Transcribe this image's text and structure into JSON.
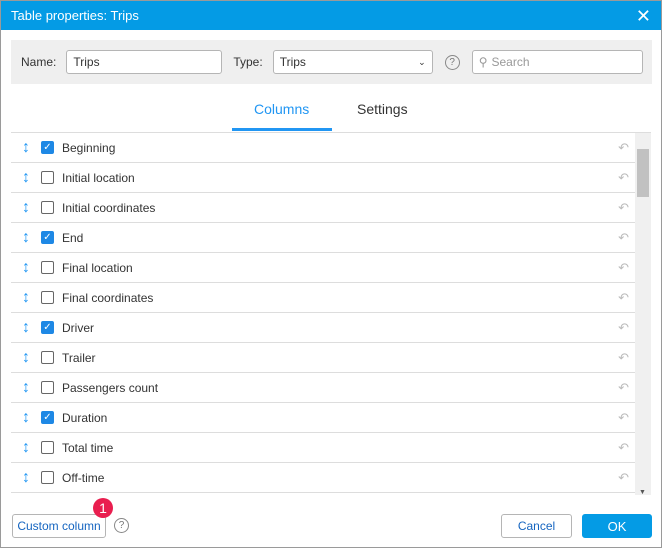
{
  "title": "Table properties: Trips",
  "name_label": "Name:",
  "name_value": "Trips",
  "type_label": "Type:",
  "type_value": "Trips",
  "search_placeholder": "Search",
  "tabs": [
    "Columns",
    "Settings"
  ],
  "rows": [
    {
      "label": "Beginning",
      "checked": true
    },
    {
      "label": "Initial location",
      "checked": false
    },
    {
      "label": "Initial coordinates",
      "checked": false
    },
    {
      "label": "End",
      "checked": true
    },
    {
      "label": "Final location",
      "checked": false
    },
    {
      "label": "Final coordinates",
      "checked": false
    },
    {
      "label": "Driver",
      "checked": true
    },
    {
      "label": "Trailer",
      "checked": false
    },
    {
      "label": "Passengers count",
      "checked": false
    },
    {
      "label": "Duration",
      "checked": true
    },
    {
      "label": "Total time",
      "checked": false
    },
    {
      "label": "Off-time",
      "checked": false
    }
  ],
  "custom_column": "Custom column",
  "badge": "1",
  "cancel": "Cancel",
  "ok": "OK"
}
